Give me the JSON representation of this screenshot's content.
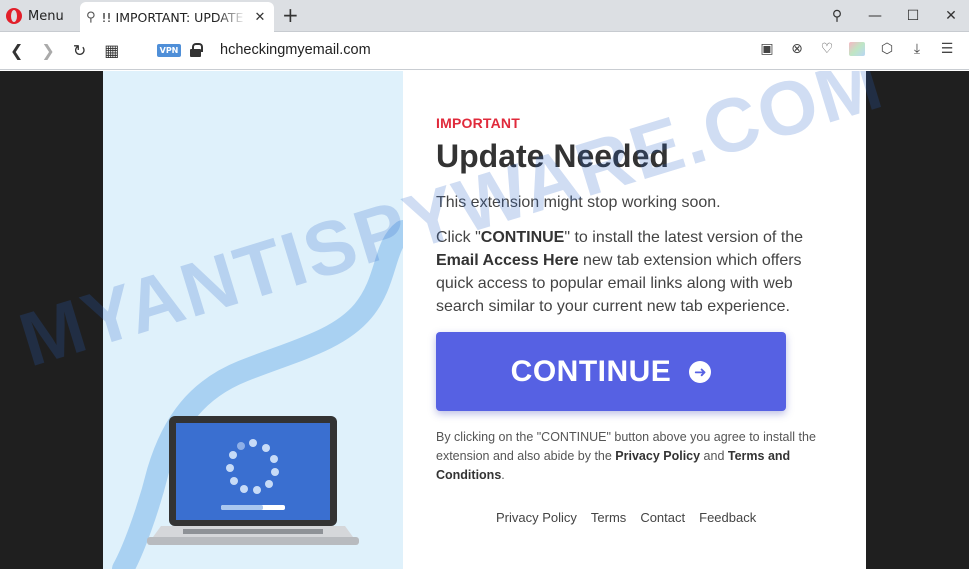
{
  "browser": {
    "menu_label": "Menu",
    "tab_title": "!! IMPORTANT: UPDATE",
    "url": "hcheckingmyemail.com",
    "vpn_badge": "VPN"
  },
  "page": {
    "kicker": "IMPORTANT",
    "headline": "Update Needed",
    "subline": "This extension might stop working soon.",
    "desc_pre": "Click \"",
    "desc_continue": "CONTINUE",
    "desc_mid": "\" to install the latest version of the ",
    "desc_ext": "Email Access Here",
    "desc_post": " new tab extension which offers quick access to popular email links along with web search similar to your current new tab experience.",
    "cta_label": "CONTINUE",
    "legal_pre": "By clicking on the \"CONTINUE\" button above you agree to install the extension and also abide by the ",
    "legal_privacy": "Privacy Policy",
    "legal_and": " and ",
    "legal_terms": "Terms and Conditions",
    "legal_end": ".",
    "footer": [
      "Privacy Policy",
      "Terms",
      "Contact",
      "Feedback"
    ]
  },
  "watermark": "MYANTISPYWARE.COM",
  "colors": {
    "accent": "#5661e3",
    "kicker": "#e02a3b",
    "panel": "#dff1fb",
    "laptop_screen": "#3a6fd0"
  }
}
